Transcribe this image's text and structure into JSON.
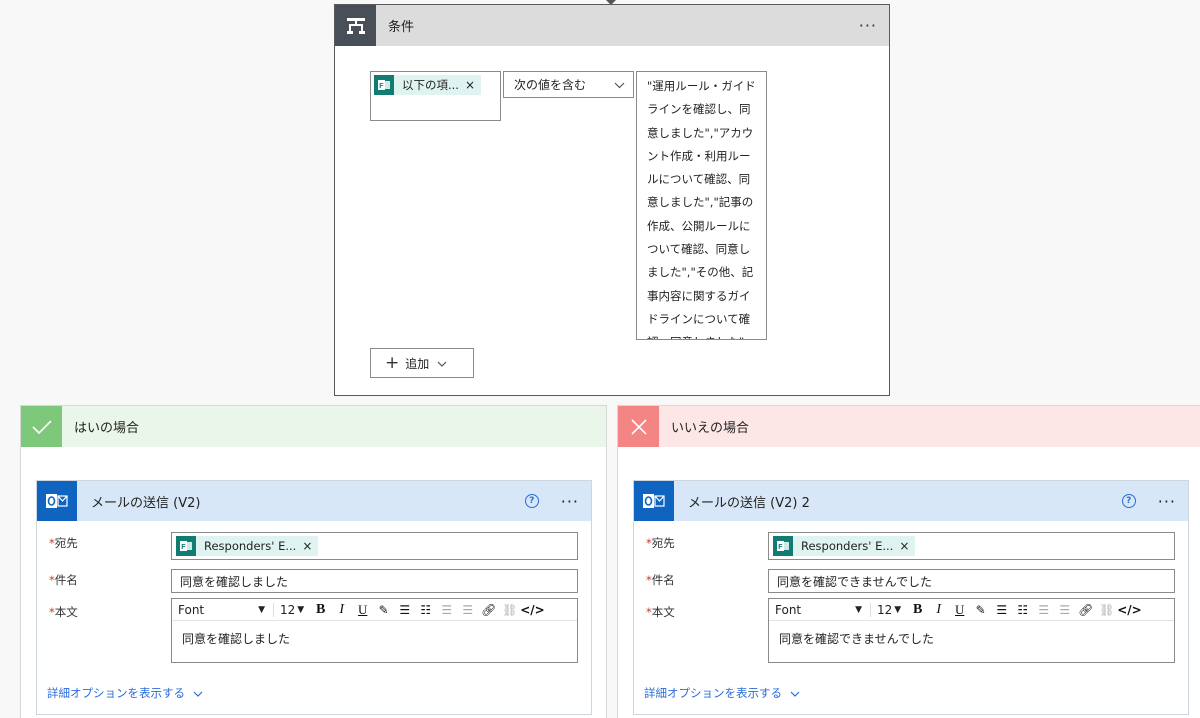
{
  "condition": {
    "title": "条件",
    "left_token": "以下の項...",
    "operator": "次の値を含む",
    "right_value": "\"運用ルール・ガイドラインを確認し、同意しました\",\"アカウント作成・利用ルールについて確認、同意しました\",\"記事の作成、公開ルールについて確認、同意しました\",\"その他、記事内容に関するガイドラインについて確認、同意しました\"",
    "add_label": "追加"
  },
  "yes_branch": {
    "label": "はいの場合",
    "action": {
      "title": "メールの送信 (V2)",
      "to_label": "宛先",
      "to_token": "Responders' E...",
      "subject_label": "件名",
      "subject_value": "同意を確認しました",
      "body_label": "本文",
      "font": "Font",
      "font_size": "12",
      "body_value": "同意を確認しました",
      "advanced_label": "詳細オプションを表示する"
    }
  },
  "no_branch": {
    "label": "いいえの場合",
    "action": {
      "title": "メールの送信 (V2) 2",
      "to_label": "宛先",
      "to_token": "Responders' E...",
      "subject_label": "件名",
      "subject_value": "同意を確認できませんでした",
      "body_label": "本文",
      "font": "Font",
      "font_size": "12",
      "body_value": "同意を確認できませんでした",
      "advanced_label": "詳細オプションを表示する"
    }
  },
  "colors": {
    "condition_header": "#dcdcdc",
    "condition_icon_bg": "#484f58",
    "yes_accent": "#7ec87c",
    "no_accent": "#f48585",
    "mail_header": "#d7e7f7",
    "outlook_blue": "#0f64c0",
    "forms_teal": "#107c72",
    "link_blue": "#2b6cd8"
  }
}
